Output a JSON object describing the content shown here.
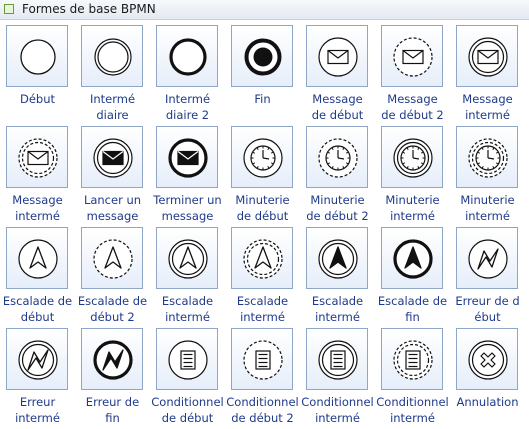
{
  "panel": {
    "title": "Formes de base BPMN"
  },
  "shapes": [
    {
      "label": "Début",
      "icon": "start-event-icon"
    },
    {
      "label": "Intermé\ndiaire",
      "icon": "intermediate-event-icon"
    },
    {
      "label": "Intermé\ndiaire 2",
      "icon": "intermediate-event-2-icon"
    },
    {
      "label": "Fin",
      "icon": "end-event-icon"
    },
    {
      "label": "Message\nde début",
      "icon": "message-start-icon"
    },
    {
      "label": "Message\nde début 2",
      "icon": "message-start-2-icon"
    },
    {
      "label": "Message\nintermé",
      "icon": "message-intermediate-icon"
    },
    {
      "label": "Message\nintermé",
      "icon": "message-intermediate-dashed-icon"
    },
    {
      "label": "Lancer un\nmessage",
      "icon": "throw-message-icon"
    },
    {
      "label": "Terminer un\nmessage",
      "icon": "end-message-icon"
    },
    {
      "label": "Minuterie\nde début",
      "icon": "timer-start-icon"
    },
    {
      "label": "Minuterie\nde début 2",
      "icon": "timer-start-2-icon"
    },
    {
      "label": "Minuterie\nintermé",
      "icon": "timer-intermediate-icon"
    },
    {
      "label": "Minuterie\nintermé",
      "icon": "timer-intermediate-dashed-icon"
    },
    {
      "label": "Escalade de\ndébut",
      "icon": "escalation-start-icon"
    },
    {
      "label": "Escalade de\ndébut 2",
      "icon": "escalation-start-2-icon"
    },
    {
      "label": "Escalade\nintermé",
      "icon": "escalation-intermediate-icon"
    },
    {
      "label": "Escalade\nintermé",
      "icon": "escalation-intermediate-dashed-icon"
    },
    {
      "label": "Escalade\nintermé",
      "icon": "escalation-throw-icon"
    },
    {
      "label": "Escalade de\nfin",
      "icon": "escalation-end-icon"
    },
    {
      "label": "Erreur de d\nébut",
      "icon": "error-start-icon"
    },
    {
      "label": "Erreur\nintermé",
      "icon": "error-intermediate-icon"
    },
    {
      "label": "Erreur de\nfin",
      "icon": "error-end-icon"
    },
    {
      "label": "Conditionnel\nde début",
      "icon": "conditional-start-icon"
    },
    {
      "label": "Conditionnel\nde début 2",
      "icon": "conditional-start-2-icon"
    },
    {
      "label": "Conditionnel\nintermé",
      "icon": "conditional-intermediate-icon"
    },
    {
      "label": "Conditionnel\nintermé",
      "icon": "conditional-intermediate-dashed-icon"
    },
    {
      "label": "Annulation",
      "icon": "cancel-icon"
    }
  ]
}
